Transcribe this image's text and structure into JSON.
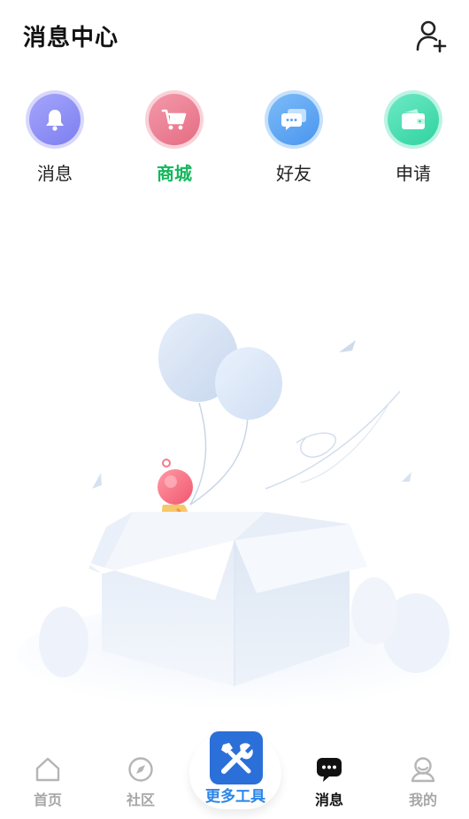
{
  "header": {
    "title": "消息中心",
    "add_friend_icon": "user-plus-icon"
  },
  "quick_actions": [
    {
      "label": "消息",
      "icon": "bell-icon",
      "color": "#8b8cf3",
      "active": false
    },
    {
      "label": "商城",
      "icon": "cart-icon",
      "color": "#ef7e92",
      "active": true
    },
    {
      "label": "好友",
      "icon": "chat-icon",
      "color": "#5aa6f3",
      "active": false
    },
    {
      "label": "申请",
      "icon": "wallet-icon",
      "color": "#3fdcae",
      "active": false
    }
  ],
  "colors": {
    "active_green": "#12b85b",
    "tools_blue": "#2b6fd9",
    "tools_text": "#2b86e8",
    "inactive_nav": "#a7a7a7"
  },
  "nav": {
    "home": "首页",
    "community": "社区",
    "tools": "更多工具",
    "messages": "消息",
    "mine": "我的"
  }
}
